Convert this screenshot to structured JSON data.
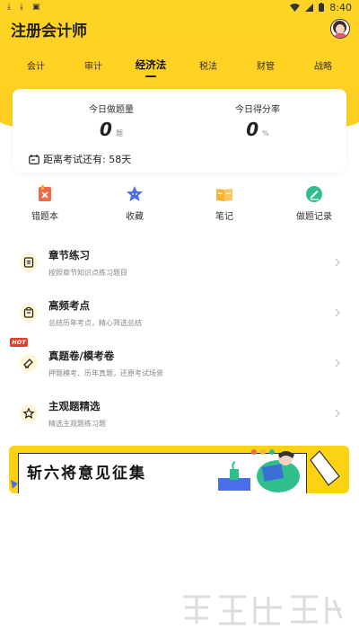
{
  "status_bar": {
    "time": "8:40"
  },
  "app": {
    "title": "注册会计师"
  },
  "tabs": [
    {
      "label": "会计",
      "active": false
    },
    {
      "label": "审计",
      "active": false
    },
    {
      "label": "经济法",
      "active": true
    },
    {
      "label": "税法",
      "active": false
    },
    {
      "label": "财管",
      "active": false
    },
    {
      "label": "战略",
      "active": false
    }
  ],
  "stats": {
    "today_count_label": "今日做题量",
    "today_count_value": "0",
    "today_count_unit": "题",
    "today_score_label": "今日得分率",
    "today_score_value": "0",
    "today_score_unit": "%",
    "countdown_text": "距离考试还有: 58天"
  },
  "quick_actions": [
    {
      "label": "错题本",
      "icon": "wrong-book-icon",
      "color": "#f06a4a"
    },
    {
      "label": "收藏",
      "icon": "star-icon",
      "color": "#4a6ee8"
    },
    {
      "label": "笔记",
      "icon": "notes-icon",
      "color": "#f5b43a"
    },
    {
      "label": "做题记录",
      "icon": "record-icon",
      "color": "#2fbf8a"
    }
  ],
  "menu": [
    {
      "title": "章节练习",
      "subtitle": "按照章节知识点练习题目",
      "icon": "chapter-icon"
    },
    {
      "title": "高频考点",
      "subtitle": "总结历年考点，精心筛选总结",
      "icon": "frequent-icon"
    },
    {
      "title": "真题卷/模考卷",
      "subtitle": "押题模考、历年真题，还原考试场景",
      "icon": "exam-paper-icon",
      "badge": "HOT"
    },
    {
      "title": "主观题精选",
      "subtitle": "精选主观题练习题",
      "icon": "subjective-icon"
    }
  ],
  "banner": {
    "text": "斩六将意见征集"
  },
  "colors": {
    "brand_yellow": "#ffd426",
    "hot_red": "#e0402a"
  }
}
